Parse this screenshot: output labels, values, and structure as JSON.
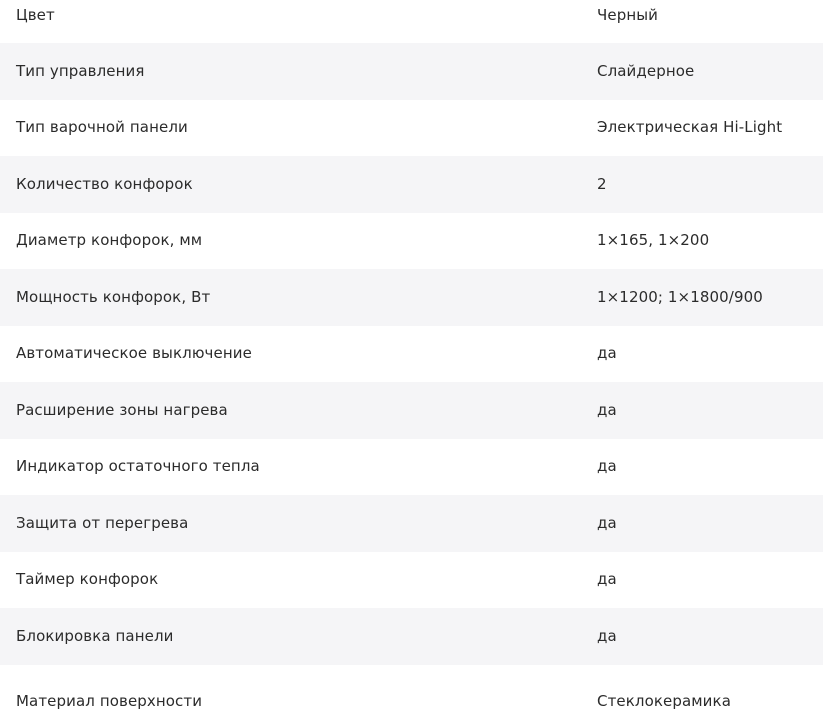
{
  "specs": [
    {
      "label": "Цвет",
      "value": "Черный"
    },
    {
      "label": "Тип управления",
      "value": "Слайдерное"
    },
    {
      "label": "Тип варочной панели",
      "value": "Электрическая Hi-Light"
    },
    {
      "label": "Количество конфорок",
      "value": "2"
    },
    {
      "label": "Диаметр конфорок, мм",
      "value": "1×165, 1×200"
    },
    {
      "label": "Мощность конфорок, Вт",
      "value": "1×1200; 1×1800/900"
    },
    {
      "label": "Автоматическое выключение",
      "value": "да"
    },
    {
      "label": "Расширение зоны нагрева",
      "value": "да"
    },
    {
      "label": "Индикатор остаточного тепла",
      "value": "да"
    },
    {
      "label": "Защита от перегрева",
      "value": "да"
    },
    {
      "label": "Таймер конфорок",
      "value": "да"
    },
    {
      "label": "Блокировка панели",
      "value": "да"
    },
    {
      "label": "Материал поверхности",
      "value": "Стеклокерамика"
    }
  ]
}
